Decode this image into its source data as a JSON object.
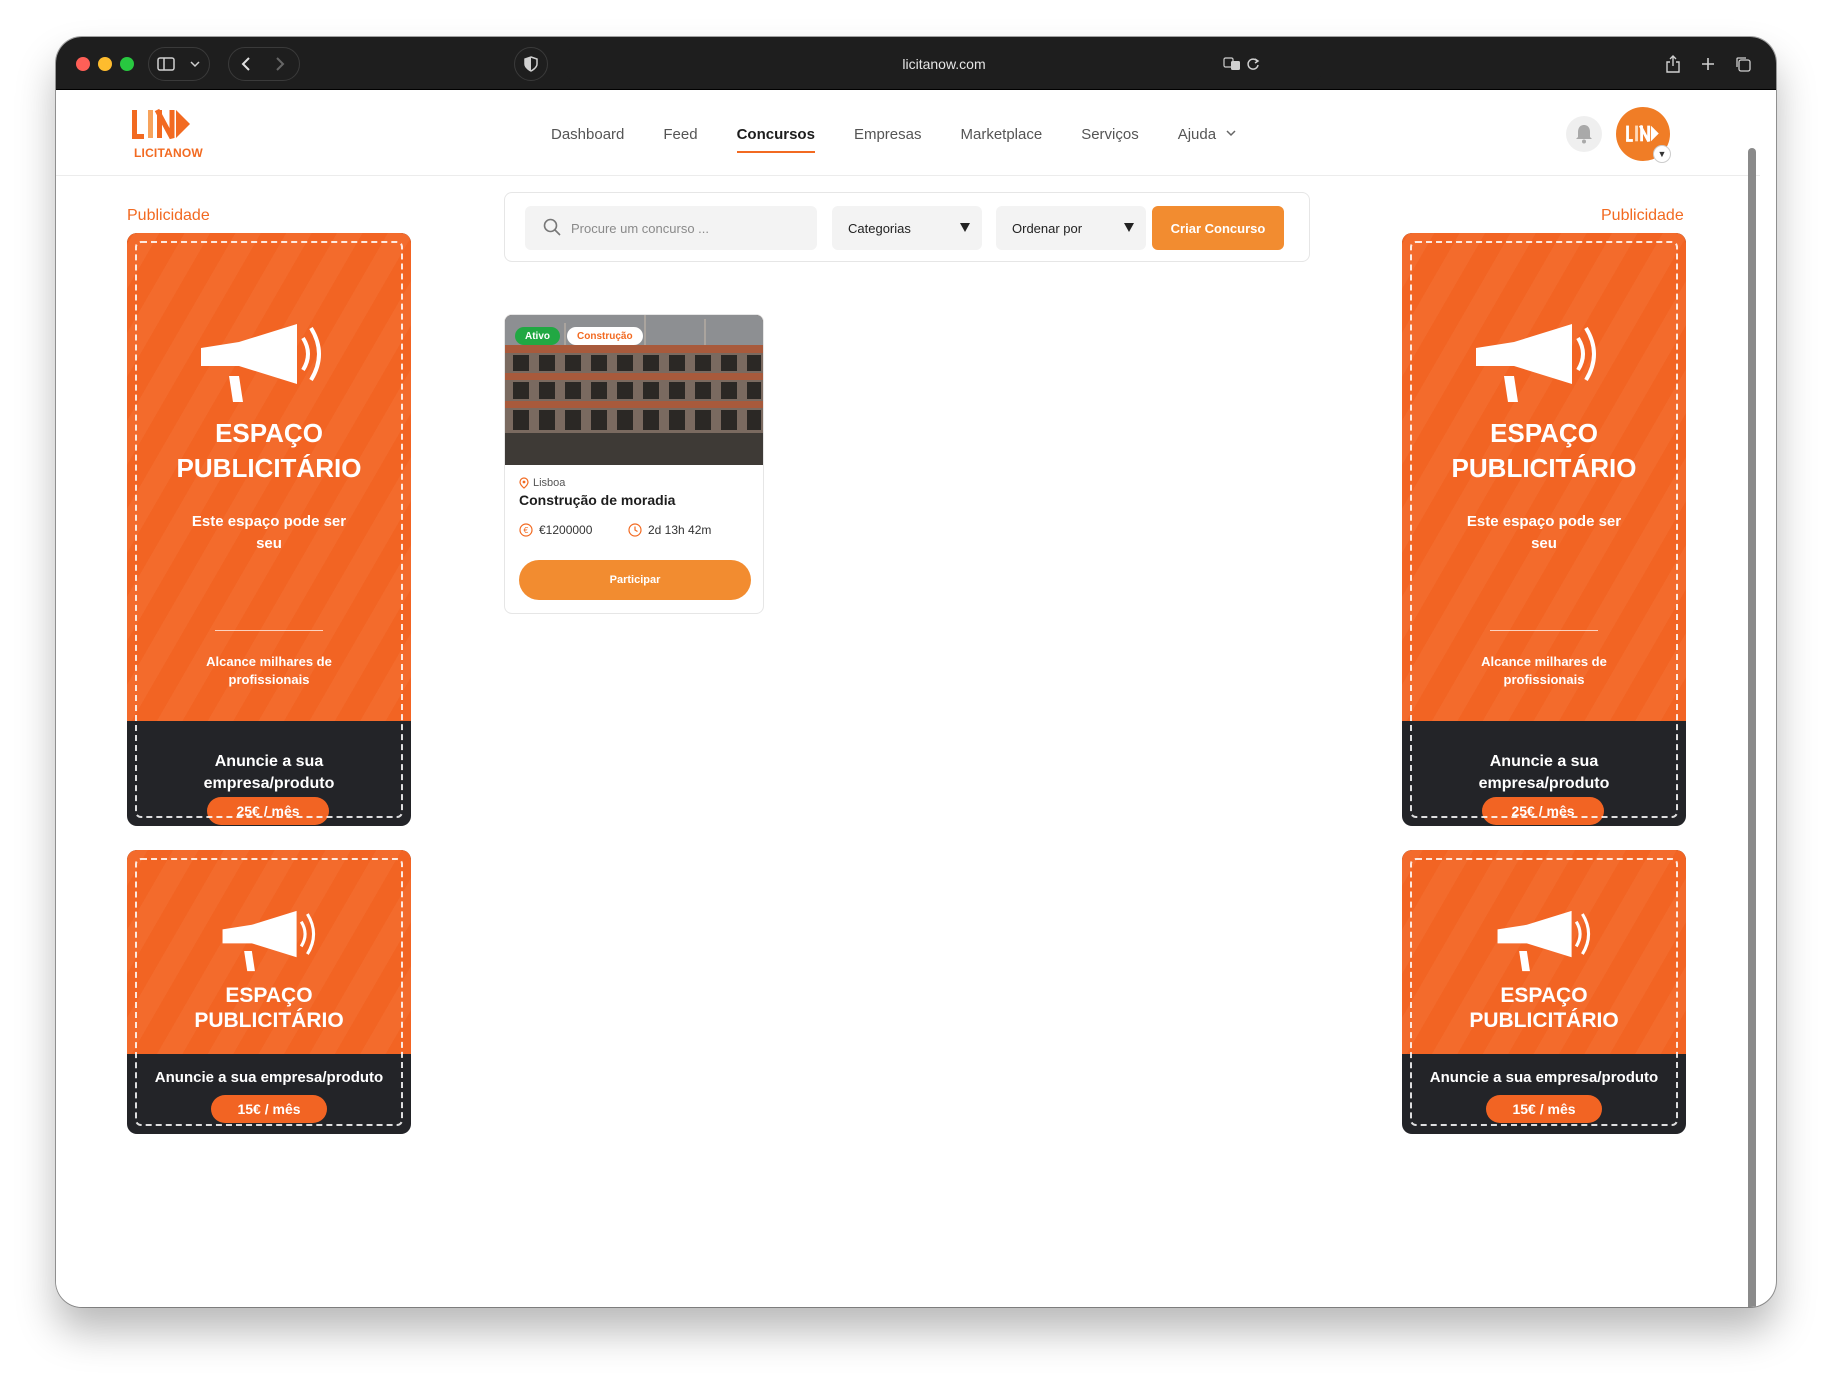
{
  "browser": {
    "url": "licitanow.com"
  },
  "brand": {
    "name": "LICITANOW",
    "accent_color": "#f26a21"
  },
  "nav": {
    "items": [
      {
        "label": "Dashboard",
        "active": false
      },
      {
        "label": "Feed",
        "active": false
      },
      {
        "label": "Concursos",
        "active": true
      },
      {
        "label": "Empresas",
        "active": false
      },
      {
        "label": "Marketplace",
        "active": false
      },
      {
        "label": "Serviços",
        "active": false
      },
      {
        "label": "Ajuda",
        "active": false,
        "dropdown": true
      }
    ]
  },
  "ads": {
    "label": "Publicidade",
    "big": {
      "title_line1": "ESPAÇO",
      "title_line2": "PUBLICITÁRIO",
      "subtitle": "Este espaço pode ser seu",
      "reach": "Alcance milhares de profissionais",
      "cta": "Anuncie a sua empresa/produto",
      "price": "25€ / mês"
    },
    "small": {
      "title_line1": "ESPAÇO",
      "title_line2": "PUBLICITÁRIO",
      "cta": "Anuncie a sua empresa/produto",
      "price": "15€ / mês"
    }
  },
  "filters": {
    "search_placeholder": "Procure um concurso ...",
    "categories": "Categorias",
    "sort": "Ordenar por",
    "create_button": "Criar Concurso"
  },
  "contest": {
    "status": "Ativo",
    "category": "Construção",
    "location": "Lisboa",
    "title": "Construção de moradia",
    "budget": "€1200000",
    "time_left": "2d 13h 42m",
    "button": "Participar"
  }
}
